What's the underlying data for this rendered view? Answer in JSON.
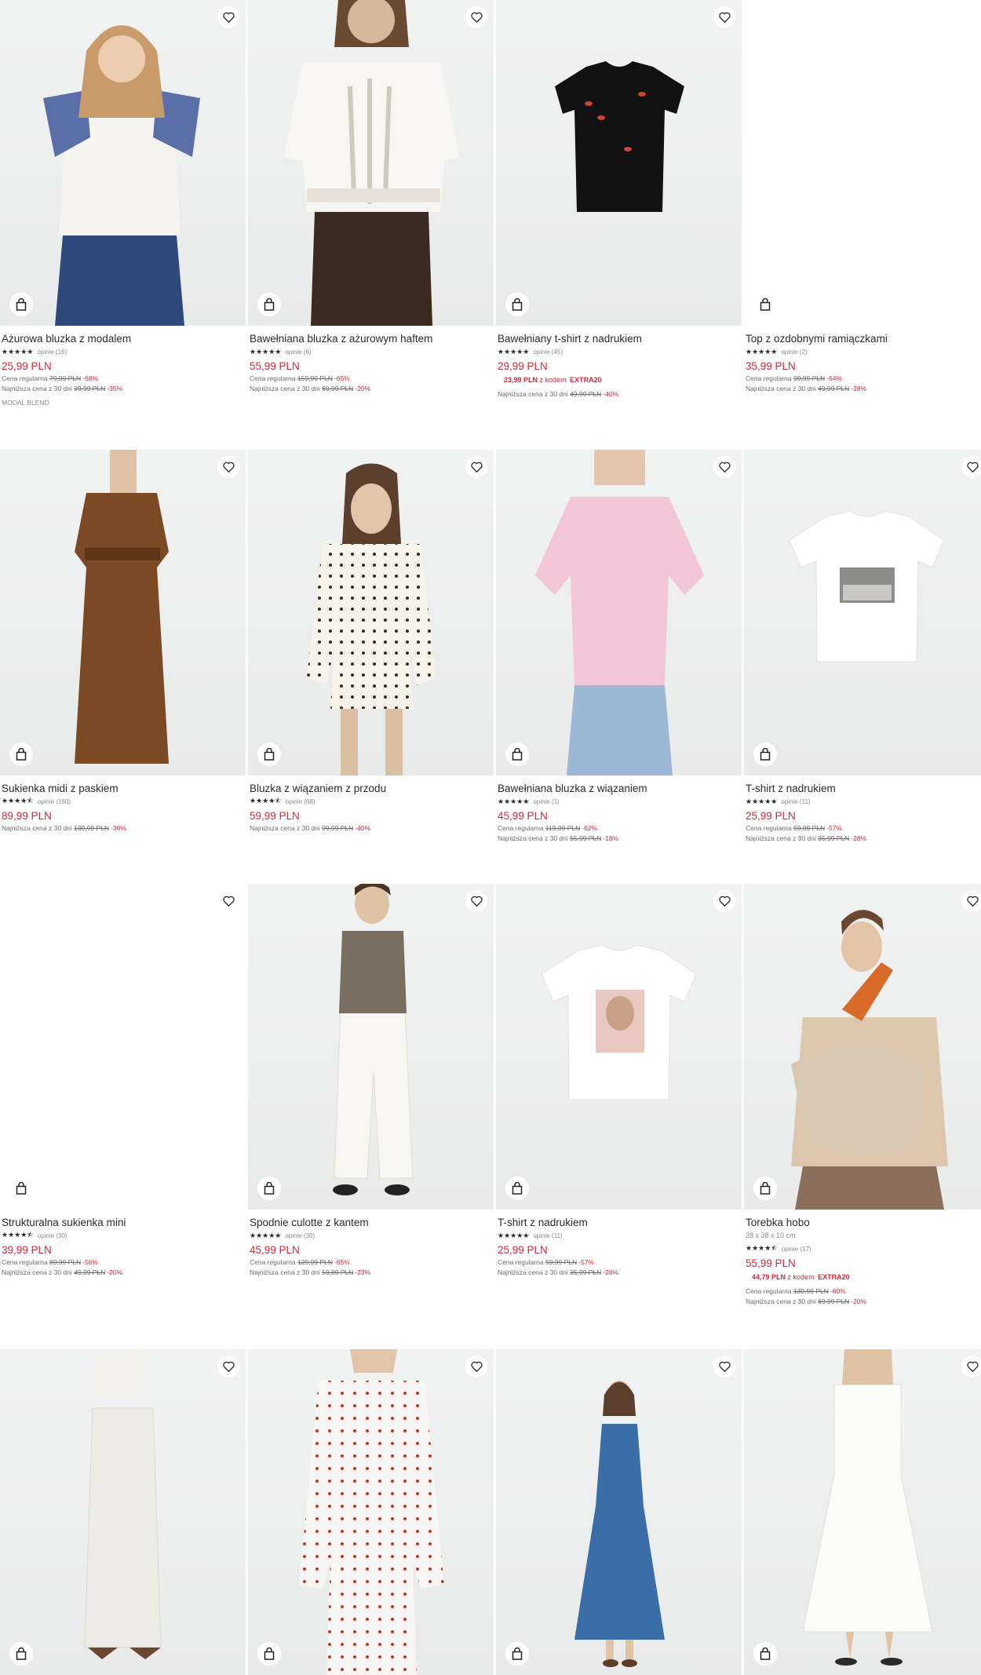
{
  "products": [
    {
      "name": "Ażurowa bluzka z modalem",
      "stars": "★★★★★",
      "reviews": "opinie (16)",
      "price": "25,99 PLN",
      "regular_label": "Cena regularna",
      "regular_price": "79,99 PLN",
      "regular_pct": "-68%",
      "lowest_label": "Najniższa cena z 30 dni",
      "lowest_price": "39,99 PLN",
      "lowest_pct": "-35%",
      "tag": "MODAL BLEND",
      "image": "model in white blouse with blue embroidered sleeves",
      "wishlist_icon": "heart-icon",
      "bag_icon": "shopping-bag-icon"
    },
    {
      "name": "Bawełniana bluzka z ażurowym haftem",
      "stars": "★★★★★",
      "reviews": "opinie (6)",
      "price": "55,99 PLN",
      "regular_label": "Cena regularna",
      "regular_price": "159,99 PLN",
      "regular_pct": "-65%",
      "lowest_label": "Najniższa cena z 30 dni",
      "lowest_price": "69,99 PLN",
      "lowest_pct": "-20%"
    },
    {
      "name": "Bawełniany t-shirt z nadrukiem",
      "stars": "★★★★★",
      "reviews": "opinie (45)",
      "price": "29,99 PLN",
      "promo_price": "23,99 PLN",
      "promo_text": "z kodem",
      "promo_code": "EXTRA20",
      "lowest_label": "Najniższa cena z 30 dni",
      "lowest_price": "49,99 PLN",
      "lowest_pct": "-40%"
    },
    {
      "name": "Top z ozdobnymi ramiączkami",
      "stars": "★★★★★",
      "reviews": "opinie (2)",
      "price": "35,99 PLN",
      "regular_label": "Cena regularna",
      "regular_price": "99,99 PLN",
      "regular_pct": "-64%",
      "lowest_label": "Najniższa cena z 30 dni",
      "lowest_price": "49,99 PLN",
      "lowest_pct": "-28%"
    },
    {
      "name": "Sukienka midi z paskiem",
      "stars": "★★★★⯪",
      "reviews": "opinie (160)",
      "price": "89,99 PLN",
      "lowest_label": "Najniższa cena z 30 dni",
      "lowest_price": "139,99 PLN",
      "lowest_pct": "-36%"
    },
    {
      "name": "Bluzka z wiązaniem z przodu",
      "stars": "★★★★⯪",
      "reviews": "opinie (68)",
      "price": "59,99 PLN",
      "lowest_label": "Najniższa cena z 30 dni",
      "lowest_price": "99,99 PLN",
      "lowest_pct": "-40%"
    },
    {
      "name": "Bawełniana bluzka z wiązaniem",
      "stars": "★★★★★",
      "reviews": "opinie (1)",
      "price": "45,99 PLN",
      "regular_label": "Cena regularna",
      "regular_price": "119,99 PLN",
      "regular_pct": "-62%",
      "lowest_label": "Najniższa cena z 30 dni",
      "lowest_price": "55,99 PLN",
      "lowest_pct": "-18%"
    },
    {
      "name": "T-shirt z nadrukiem",
      "stars": "★★★★★",
      "reviews": "opinie (11)",
      "price": "25,99 PLN",
      "regular_label": "Cena regularna",
      "regular_price": "59,99 PLN",
      "regular_pct": "-57%",
      "lowest_label": "Najniższa cena z 30 dni",
      "lowest_price": "35,99 PLN",
      "lowest_pct": "-28%"
    },
    {
      "name": "Strukturalna sukienka mini",
      "stars": "★★★★⯪",
      "reviews": "opinie (30)",
      "price": "39,99 PLN",
      "regular_label": "Cena regularna",
      "regular_price": "89,99 PLN",
      "regular_pct": "-56%",
      "lowest_label": "Najniższa cena z 30 dni",
      "lowest_price": "49,99 PLN",
      "lowest_pct": "-20%"
    },
    {
      "name": "Spodnie culotte z kantem",
      "stars": "★★★★★",
      "reviews": "opinie (30)",
      "price": "45,99 PLN",
      "regular_label": "Cena regularna",
      "regular_price": "129,99 PLN",
      "regular_pct": "-65%",
      "lowest_label": "Najniższa cena z 30 dni",
      "lowest_price": "59,99 PLN",
      "lowest_pct": "-23%"
    },
    {
      "name": "T-shirt z nadrukiem",
      "stars": "★★★★★",
      "reviews": "opinie (11)",
      "price": "25,99 PLN",
      "regular_label": "Cena regularna",
      "regular_price": "59,99 PLN",
      "regular_pct": "-57%",
      "lowest_label": "Najniższa cena z 30 dni",
      "lowest_price": "35,99 PLN",
      "lowest_pct": "-28%"
    },
    {
      "name": "Torebka hobo",
      "subtitle": "28 x 38 x 10 cm",
      "stars": "★★★★⯪",
      "reviews": "opinie (17)",
      "price": "55,99 PLN",
      "promo_price": "44,79 PLN",
      "promo_text": "z kodem",
      "promo_code": "EXTRA20",
      "regular_label": "Cena regularna",
      "regular_price": "139,99 PLN",
      "regular_pct": "-60%",
      "lowest_label": "Najniższa cena z 30 dni",
      "lowest_price": "69,99 PLN",
      "lowest_pct": "-20%"
    },
    {
      "name": ""
    },
    {
      "name": ""
    },
    {
      "name": ""
    },
    {
      "name": ""
    }
  ],
  "colors": {
    "accent_red": "#d4293a",
    "text": "#2b2b2b",
    "image_bg": "#eceded"
  }
}
